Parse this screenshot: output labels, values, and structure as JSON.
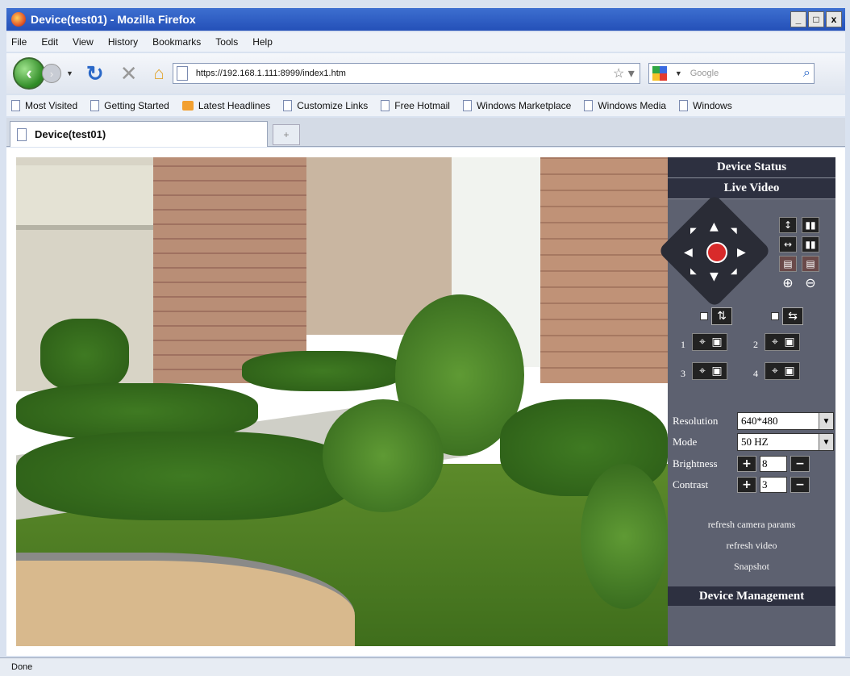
{
  "window": {
    "title": "Device(test01) - Mozilla Firefox",
    "min": "_",
    "max": "□",
    "close": "x"
  },
  "menu": [
    "File",
    "Edit",
    "View",
    "History",
    "Bookmarks",
    "Tools",
    "Help"
  ],
  "nav": {
    "url": "https://192.168.1.111:8999/index1.htm",
    "search_placeholder": "Google"
  },
  "bookmarks": [
    "Most Visited",
    "Getting Started",
    "Latest Headlines",
    "Customize Links",
    "Free Hotmail",
    "Windows Marketplace",
    "Windows Media",
    "Windows"
  ],
  "tab": {
    "label": "Device(test01)",
    "new_tab": "+"
  },
  "panel": {
    "device_status": "Device Status",
    "live_video": "Live Video",
    "presets": [
      "1",
      "2",
      "3",
      "4"
    ],
    "resolution_label": "Resolution",
    "resolution_value": "640*480",
    "mode_label": "Mode",
    "mode_value": "50 HZ",
    "brightness_label": "Brightness",
    "brightness_value": "8",
    "contrast_label": "Contrast",
    "contrast_value": "3",
    "refresh_params": "refresh camera params",
    "refresh_video": "refresh video",
    "snapshot": "Snapshot",
    "device_management": "Device Management"
  },
  "status": "Done"
}
